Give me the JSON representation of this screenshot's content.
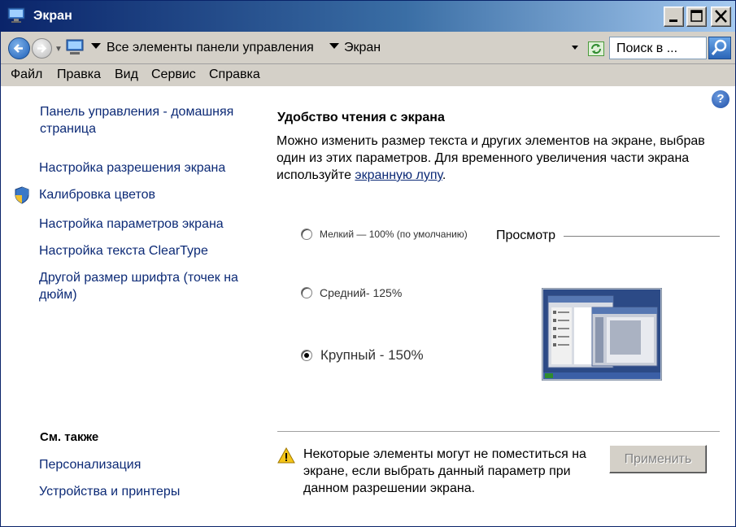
{
  "window": {
    "title": "Экран"
  },
  "address": {
    "crumbs": [
      "Все элементы панели управления",
      "Экран"
    ],
    "search_placeholder": "Поиск в ..."
  },
  "menu": [
    "Файл",
    "Правка",
    "Вид",
    "Сервис",
    "Справка"
  ],
  "sidebar": {
    "home_link": "Панель управления - домашняя страница",
    "links": [
      "Настройка разрешения экрана",
      "Калибровка цветов",
      "Настройка параметров экрана",
      "Настройка текста ClearType",
      "Другой размер шрифта (точек на дюйм)"
    ],
    "see_also_heading": "См. также",
    "see_also": [
      "Персонализация",
      "Устройства и принтеры"
    ]
  },
  "main": {
    "title": "Удобство чтения с экрана",
    "desc_before": "Можно изменить размер текста и других элементов на экране, выбрав один из этих параметров. Для временного увеличения части экрана используйте ",
    "desc_link": "экранную лупу",
    "desc_after": ".",
    "options": [
      {
        "label": "Мелкий — 100% (по умолчанию)",
        "checked": false
      },
      {
        "label": "Средний- 125%",
        "checked": false
      },
      {
        "label": "Крупный - 150%",
        "checked": true
      }
    ],
    "preview_label": "Просмотр",
    "warning": "Некоторые элементы могут не поместиться на экране, если выбрать данный параметр при данном разрешении экрана.",
    "apply_label": "Применить"
  }
}
